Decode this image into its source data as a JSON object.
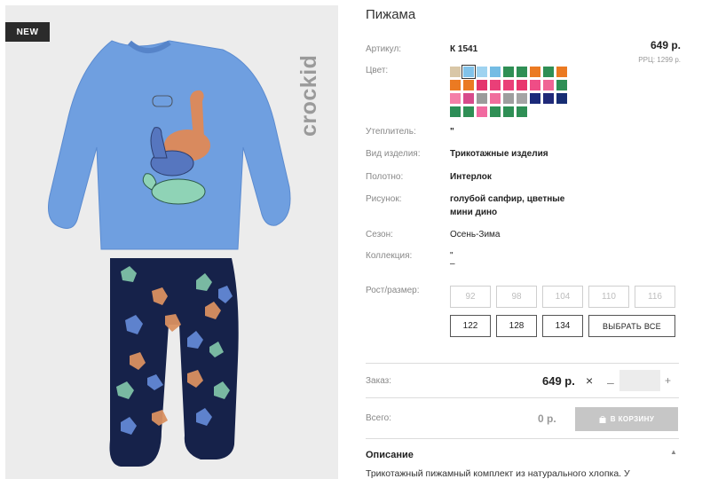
{
  "badge": "NEW",
  "brand": "crockid",
  "product": {
    "title": "Пижама",
    "article_label": "Артикул:",
    "article": "К 1541",
    "price": "649 р.",
    "rrp": "РРЦ: 1299 р.",
    "color_label": "Цвет:",
    "colors": [
      "#d9c7a7",
      "#82c3ea",
      "#9fd3f0",
      "#74bce4",
      "#2f8f55",
      "#2f8f55",
      "#eb7a22",
      "#2f8f55",
      "#eb7a22",
      "#eb7a22",
      "#ea7a23",
      "#e4356d",
      "#ea3f78",
      "#ea3f78",
      "#e8366d",
      "#ef4d86",
      "#f06495",
      "#2f8f55",
      "#f47fa8",
      "#d74b8b",
      "#9b9b9b",
      "#f06e9d",
      "#9e9e9e",
      "#a4a4a4",
      "#1b2a7a",
      "#202a79",
      "#172d73",
      "#2c8e57",
      "#2f8f55",
      "#f16aa0",
      "#2f8f55",
      "#2f8f55",
      "#2f8f55"
    ],
    "selected_color_index": 1,
    "insulation_label": "Утеплитель:",
    "insulation": "\"",
    "type_label": "Вид изделия:",
    "type": "Трикотажные изделия",
    "fabric_label": "Полотно:",
    "fabric": "Интерлок",
    "pattern_label": "Рисунок:",
    "pattern": [
      "голубой сапфир, цветные",
      "мини дино"
    ],
    "season_label": "Сезон:",
    "season": "Осень-Зима",
    "collection_label": "Коллекция:",
    "collection": [
      "\"",
      "–"
    ],
    "size_label": "Рост/размер:",
    "sizes_unavailable": [
      "92",
      "98",
      "104",
      "110",
      "116"
    ],
    "sizes_available": [
      "122",
      "128",
      "134"
    ],
    "select_all": "ВЫБРАТЬ ВСЕ"
  },
  "order": {
    "label": "Заказ:",
    "price": "649 р.",
    "close_icon": "×",
    "minus": "–",
    "quantity": "",
    "plus": "+"
  },
  "total": {
    "label": "Всего:",
    "value": "0 р.",
    "cart_button": "В КОРЗИНУ",
    "cart_icon": "bag-icon"
  },
  "description": {
    "title": "Описание",
    "toggle": "▲",
    "text": "Трикотажный пижамный комплект из натурального хлопка. У"
  }
}
